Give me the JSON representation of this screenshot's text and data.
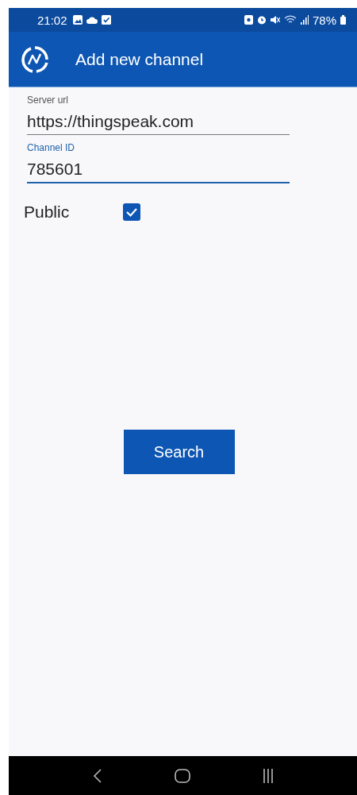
{
  "status_bar": {
    "time": "21:02",
    "battery": "78%"
  },
  "app_bar": {
    "title": "Add new channel"
  },
  "fields": [
    {
      "label": "Server url",
      "value": "https://thingspeak.com",
      "focused": false
    },
    {
      "label": "Channel ID",
      "value": "785601",
      "focused": true
    }
  ],
  "public": {
    "label": "Public",
    "checked": true
  },
  "buttons": [
    {
      "label": "Search"
    }
  ]
}
